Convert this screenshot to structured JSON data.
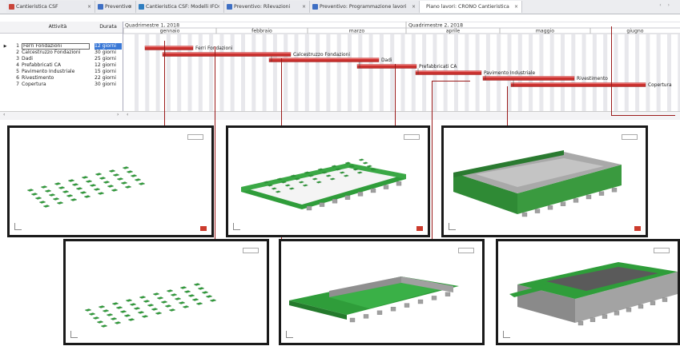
{
  "tabs": [
    {
      "label": "Cantieristica CSF",
      "color": "#c9453a"
    },
    {
      "label": "Preventivo",
      "color": "#3e6fc4"
    },
    {
      "label": "Cantieristica CSF: Modelli IFC",
      "color": "#2f7ec0"
    },
    {
      "label": "Preventivo: Rilevazioni",
      "color": "#3e6fc4"
    },
    {
      "label": "Preventivo: Programmazione lavori",
      "color": "#3e6fc4"
    },
    {
      "label": "Piano lavori: CRONO Cantieristica",
      "color": ""
    }
  ],
  "grid": {
    "col_attivita": "Attività",
    "col_durata": "Durata",
    "rows": [
      {
        "num": "1",
        "name": "Ferri Fondazioni",
        "dur": "12 giorni"
      },
      {
        "num": "2",
        "name": "Calcestruzzo Fondazioni",
        "dur": "30 giorni"
      },
      {
        "num": "3",
        "name": "Dadi",
        "dur": "25 giorni"
      },
      {
        "num": "4",
        "name": "Prefabbricati CA",
        "dur": "12 giorni"
      },
      {
        "num": "5",
        "name": "Pavimento Industriale",
        "dur": "15 giorni"
      },
      {
        "num": "6",
        "name": "Rivestimento",
        "dur": "22 giorni"
      },
      {
        "num": "7",
        "name": "Copertura",
        "dur": "30 giorni"
      }
    ]
  },
  "timeline": {
    "quarters": [
      "Quadrimestre 1, 2018",
      "Quadrimestre 2, 2018"
    ],
    "months": [
      "gennaio",
      "febbraio",
      "marzo",
      "aprile",
      "maggio",
      "giugno"
    ]
  },
  "gantt_bars": [
    {
      "label": "Ferri Fondazioni"
    },
    {
      "label": "Calcestruzzo Fondazioni"
    },
    {
      "label": "Dadi"
    },
    {
      "label": "Prefabbricati CA"
    },
    {
      "label": "Pavimento Industriale"
    },
    {
      "label": "Rivestimento"
    },
    {
      "label": "Copertura"
    }
  ],
  "colors": {
    "bar": "#c8302d",
    "bar_hi": "#ea7170",
    "leader": "#9b1b1b",
    "model_green": "#2f9d3a",
    "model_grey": "#9a9a9a"
  }
}
